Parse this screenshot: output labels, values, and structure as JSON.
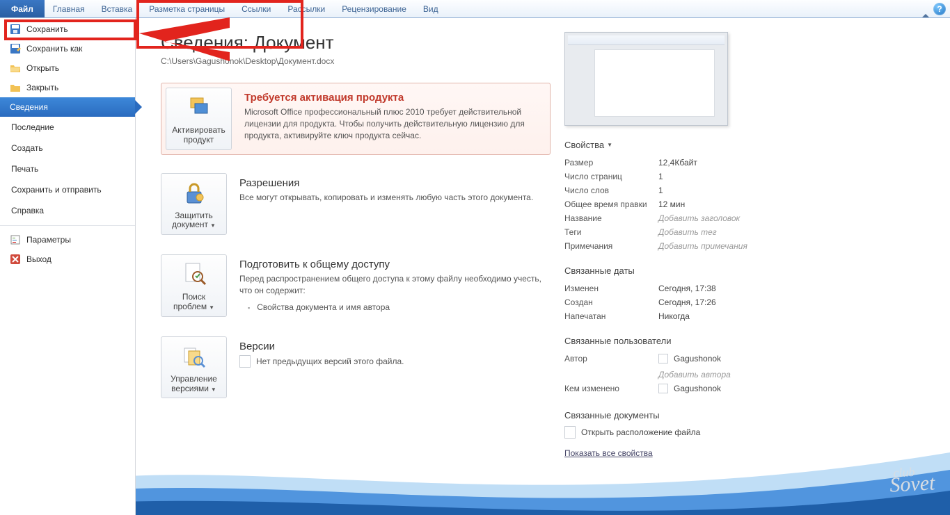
{
  "ribbon": {
    "file": "Файл",
    "tabs": [
      "Главная",
      "Вставка",
      "Разметка страницы",
      "Ссылки",
      "Рассылки",
      "Рецензирование",
      "Вид"
    ]
  },
  "sidebar": {
    "save": "Сохранить",
    "save_as": "Сохранить как",
    "open": "Открыть",
    "close": "Закрыть",
    "info": "Сведения",
    "recent": "Последние",
    "new": "Создать",
    "print": "Печать",
    "share": "Сохранить и отправить",
    "help": "Справка",
    "options": "Параметры",
    "exit": "Выход"
  },
  "page": {
    "title": "Сведения: Документ",
    "path": "C:\\Users\\Gagushonok\\Desktop\\Документ.docx"
  },
  "activation": {
    "btn": "Активировать продукт",
    "title": "Требуется активация продукта",
    "body": "Microsoft Office профессиональный плюс 2010 требует действительной лицензии для продукта. Чтобы получить действительную лицензию для продукта, активируйте ключ продукта сейчас."
  },
  "permissions": {
    "btn": "Защитить документ",
    "title": "Разрешения",
    "body": "Все могут открывать, копировать и изменять любую часть этого документа."
  },
  "prepare": {
    "btn": "Поиск проблем",
    "title": "Подготовить к общему доступу",
    "body": "Перед распространением общего доступа к этому файлу необходимо учесть, что он содержит:",
    "item1": "Свойства документа и имя автора"
  },
  "versions": {
    "btn": "Управление версиями",
    "title": "Версии",
    "none": "Нет предыдущих версий этого файла."
  },
  "props": {
    "heading": "Свойства",
    "size_l": "Размер",
    "size_v": "12,4Кбайт",
    "pages_l": "Число страниц",
    "pages_v": "1",
    "words_l": "Число слов",
    "words_v": "1",
    "edit_l": "Общее время правки",
    "edit_v": "12 мин",
    "title_l": "Название",
    "title_ph": "Добавить заголовок",
    "tags_l": "Теги",
    "tags_ph": "Добавить тег",
    "notes_l": "Примечания",
    "notes_ph": "Добавить примечания"
  },
  "dates": {
    "heading": "Связанные даты",
    "mod_l": "Изменен",
    "mod_v": "Сегодня, 17:38",
    "crt_l": "Создан",
    "crt_v": "Сегодня, 17:26",
    "prn_l": "Напечатан",
    "prn_v": "Никогда"
  },
  "people": {
    "heading": "Связанные пользователи",
    "author_l": "Автор",
    "author_v": "Gagushonok",
    "author_add": "Добавить автора",
    "modby_l": "Кем изменено",
    "modby_v": "Gagushonok"
  },
  "docs": {
    "heading": "Связанные документы",
    "open_loc": "Открыть расположение файла",
    "show_all": "Показать все свойства"
  }
}
